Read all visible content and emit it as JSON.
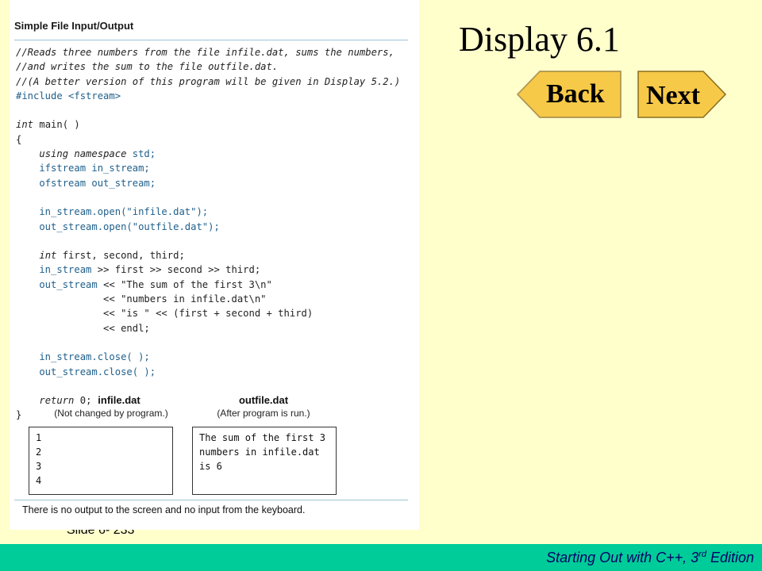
{
  "slide": {
    "title": "Display 6.1",
    "slide_number": "Slide 6- 233",
    "footer": {
      "book": "Starting Out with C++, 3",
      "superscript": "rd",
      "suffix": " Edition"
    },
    "nav": {
      "back_label": "Back",
      "next_label": "Next"
    }
  },
  "colors": {
    "background": "#ffffcc",
    "footer_bar": "#00cc99",
    "footer_text": "#000066",
    "button_fill": "#f7c948",
    "code_keyword": "#1f5f8b"
  },
  "figure": {
    "title": "Simple File Input/Output",
    "code": [
      {
        "segments": [
          {
            "text": "//Reads three numbers from the file infile.dat, sums the numbers,",
            "style": "it"
          }
        ]
      },
      {
        "segments": [
          {
            "text": "//and writes the sum to the file outfile.dat.",
            "style": "it"
          }
        ]
      },
      {
        "segments": [
          {
            "text": "//(A better version of this program will be given in Display 5.2.)",
            "style": "it"
          }
        ]
      },
      {
        "segments": [
          {
            "text": "#include <fstream>",
            "style": "blue"
          }
        ]
      },
      {
        "segments": [
          {
            "text": "",
            "style": ""
          }
        ]
      },
      {
        "segments": [
          {
            "text": "int",
            "style": "it"
          },
          {
            "text": " main( )",
            "style": ""
          }
        ]
      },
      {
        "segments": [
          {
            "text": "{",
            "style": ""
          }
        ]
      },
      {
        "segments": [
          {
            "text": "    ",
            "style": ""
          },
          {
            "text": "using namespace",
            "style": "it"
          },
          {
            "text": " std;",
            "style": "blue"
          }
        ]
      },
      {
        "segments": [
          {
            "text": "    ifstream in_stream;",
            "style": "blue"
          }
        ]
      },
      {
        "segments": [
          {
            "text": "    ofstream out_stream;",
            "style": "blue"
          }
        ]
      },
      {
        "segments": [
          {
            "text": "",
            "style": ""
          }
        ]
      },
      {
        "segments": [
          {
            "text": "    in_stream.open(\"infile.dat\");",
            "style": "blue"
          }
        ]
      },
      {
        "segments": [
          {
            "text": "    out_stream.open(\"outfile.dat\");",
            "style": "blue"
          }
        ]
      },
      {
        "segments": [
          {
            "text": "",
            "style": ""
          }
        ]
      },
      {
        "segments": [
          {
            "text": "    ",
            "style": ""
          },
          {
            "text": "int",
            "style": "it"
          },
          {
            "text": " first, second, third;",
            "style": ""
          }
        ]
      },
      {
        "segments": [
          {
            "text": "    in_stream",
            "style": "blue"
          },
          {
            "text": " >> first >> second >> third;",
            "style": ""
          }
        ]
      },
      {
        "segments": [
          {
            "text": "    out_stream",
            "style": "blue"
          },
          {
            "text": " << \"The sum of the first 3\\n\"",
            "style": ""
          }
        ]
      },
      {
        "segments": [
          {
            "text": "               << \"numbers in infile.dat\\n\"",
            "style": ""
          }
        ]
      },
      {
        "segments": [
          {
            "text": "               << \"is \" << (first + second + third)",
            "style": ""
          }
        ]
      },
      {
        "segments": [
          {
            "text": "               << endl;",
            "style": ""
          }
        ]
      },
      {
        "segments": [
          {
            "text": "",
            "style": ""
          }
        ]
      },
      {
        "segments": [
          {
            "text": "    in_stream.close( );",
            "style": "blue"
          }
        ]
      },
      {
        "segments": [
          {
            "text": "    out_stream.close( );",
            "style": "blue"
          }
        ]
      },
      {
        "segments": [
          {
            "text": "",
            "style": ""
          }
        ]
      },
      {
        "segments": [
          {
            "text": "    ",
            "style": ""
          },
          {
            "text": "return",
            "style": "it"
          },
          {
            "text": " 0;",
            "style": ""
          }
        ]
      },
      {
        "segments": [
          {
            "text": "}",
            "style": ""
          }
        ]
      }
    ],
    "infile": {
      "heading": "infile.dat",
      "subheading": "(Not changed by program.)",
      "lines": [
        "1",
        "2",
        "3",
        "4"
      ]
    },
    "outfile": {
      "heading": "outfile.dat",
      "subheading": "(After program is run.)",
      "lines": [
        "The sum of the first 3",
        "numbers in infile.dat",
        "is 6"
      ]
    },
    "note": "There is no output to the screen and no input from the keyboard."
  }
}
